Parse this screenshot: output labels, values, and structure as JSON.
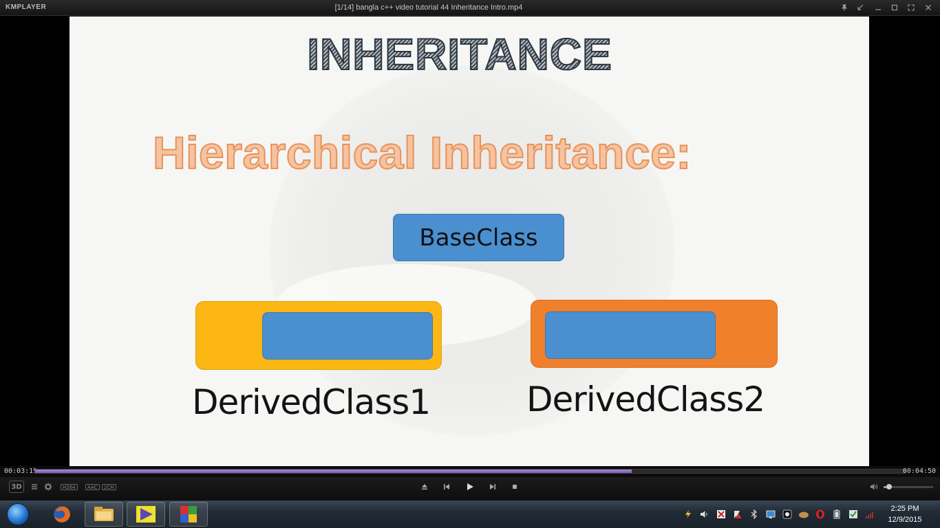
{
  "window": {
    "logo": "KMPLAYER",
    "title": "[1/14] bangla c++ video tutorial 44 Inheritance Intro.mp4"
  },
  "slide": {
    "title": "INHERITANCE",
    "subtitle": "Hierarchical Inheritance:",
    "base_label": "BaseClass",
    "derived1_label": "DerivedClass1",
    "derived2_label": "DerivedClass2",
    "colors": {
      "blue_box": "#4a8fd0",
      "derived1_box": "#fdb714",
      "derived2_box": "#f0802b",
      "subtitle_fill": "#f6c3a0"
    }
  },
  "playback": {
    "current_time": "00:03:19",
    "total_time": "00:04:50",
    "progress_fraction": 0.686,
    "accent_color": "#7a5ab8"
  },
  "controls": {
    "btn_3d": "3D",
    "badges": [
      "H264",
      "AAC",
      "2CH"
    ],
    "icons": [
      "playlist-icon",
      "settings-icon",
      "eject-icon",
      "previous-icon",
      "play-icon",
      "next-icon",
      "stop-icon",
      "volume-icon"
    ],
    "volume_fraction": 0.11
  },
  "taskbar": {
    "apps": [
      "firefox-icon",
      "file-explorer-icon",
      "media-player-icon",
      "kmplayer-icon"
    ],
    "clock_time": "2:25 PM",
    "clock_date": "12/9/2015"
  }
}
